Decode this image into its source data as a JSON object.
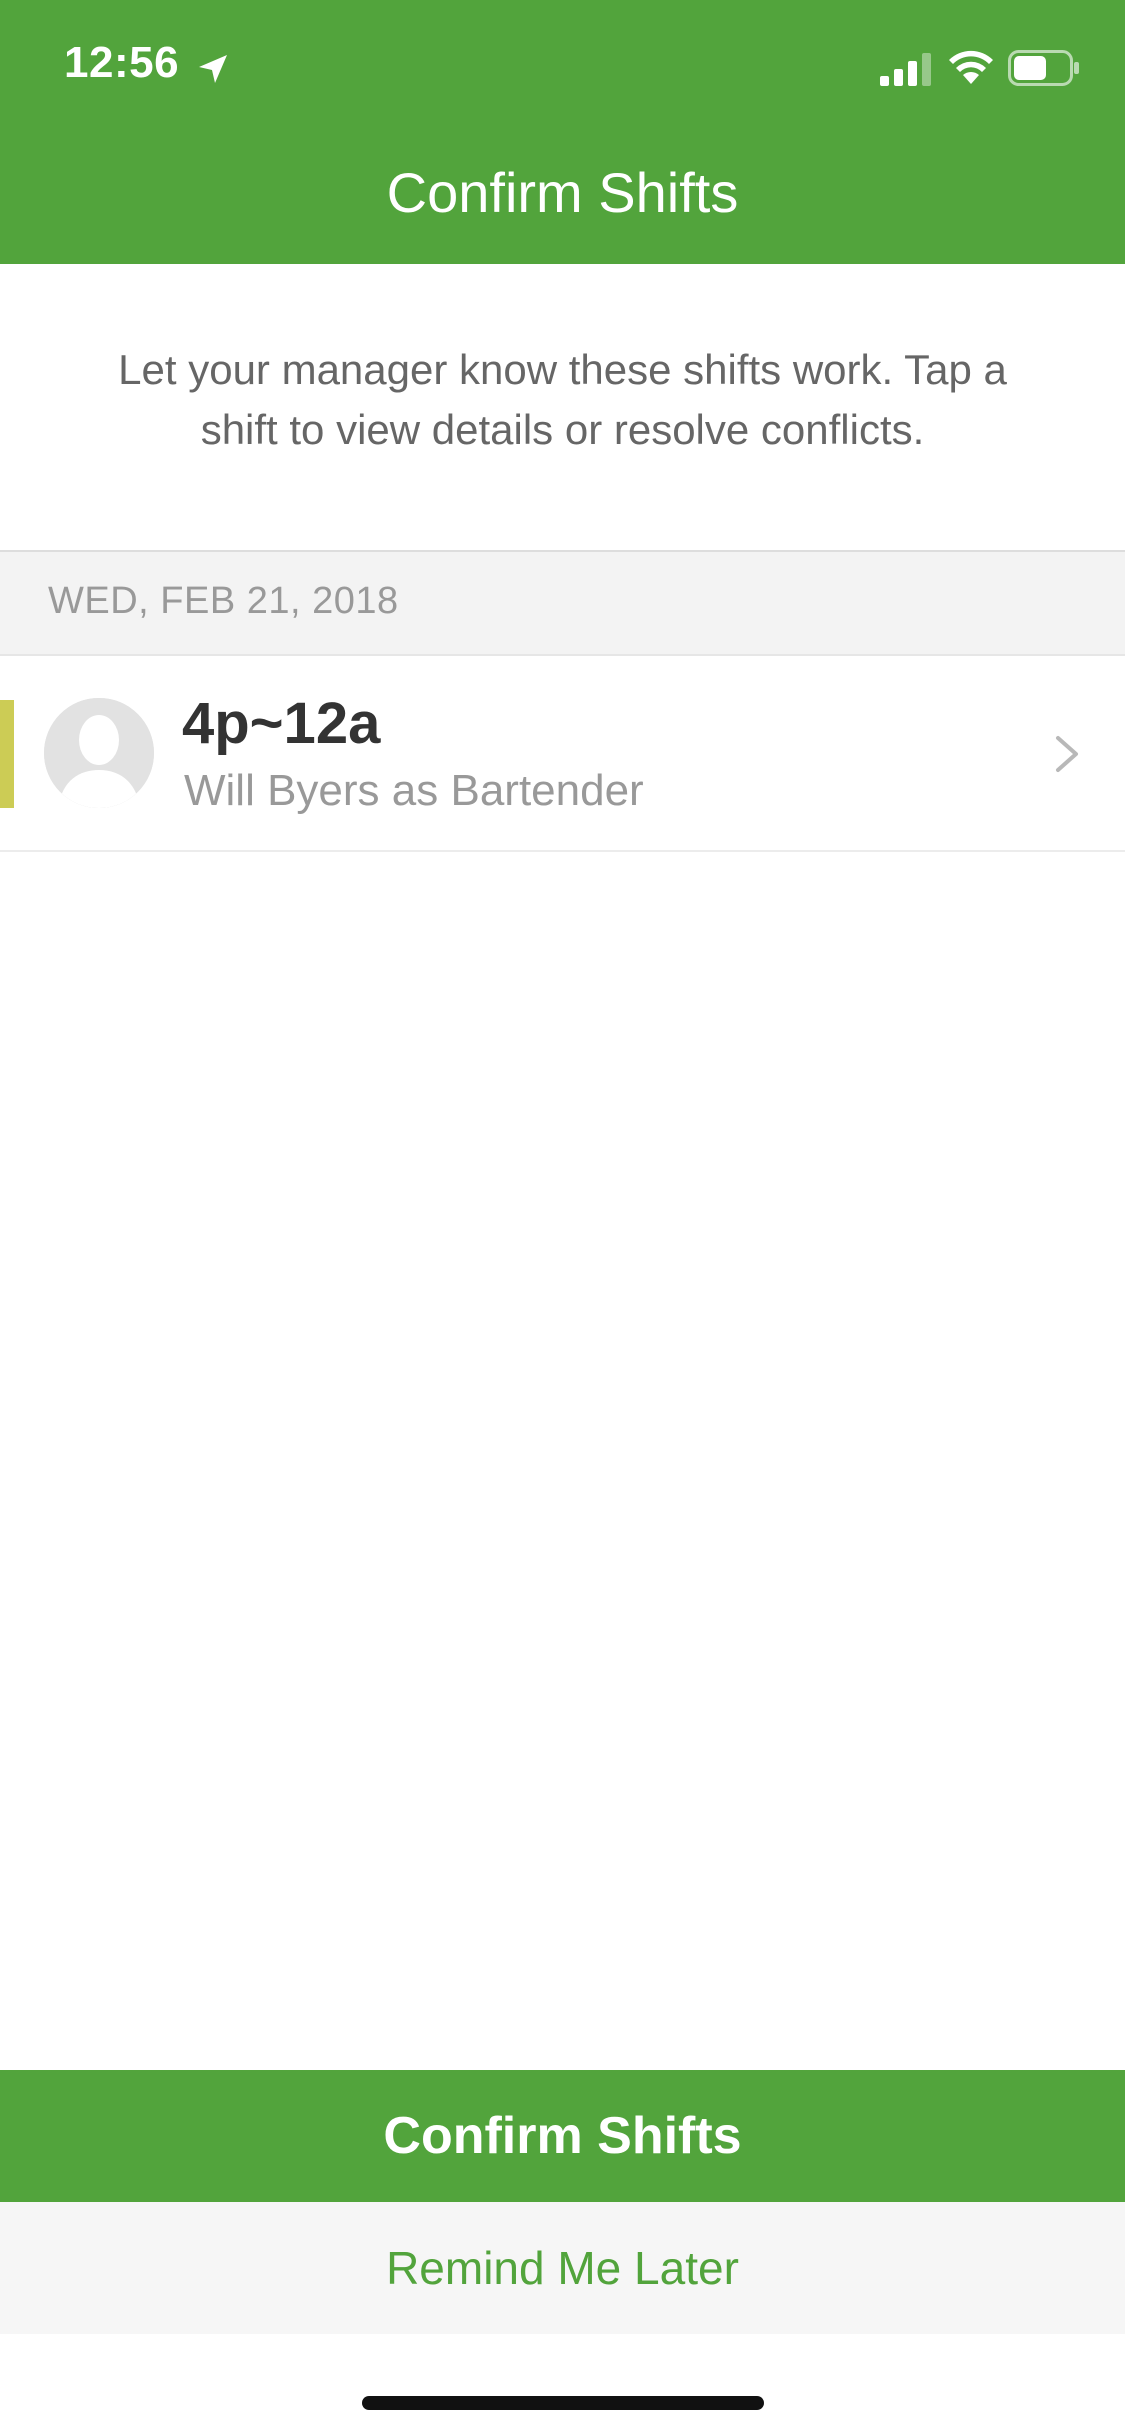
{
  "status_bar": {
    "time": "12:56",
    "icons": [
      "location-arrow-icon",
      "cellular-signal-icon",
      "wifi-icon",
      "battery-icon"
    ]
  },
  "nav": {
    "title": "Confirm Shifts"
  },
  "intro": {
    "message": "Let your manager know these shifts work. Tap a shift to view details or resolve conflicts."
  },
  "sections": [
    {
      "date": "WED, FEB 21, 2018",
      "shifts": [
        {
          "time": "4p~12a",
          "detail": "Will Byers as Bartender",
          "status_color": "#cccc55",
          "avatar": "person-placeholder-icon"
        }
      ]
    }
  ],
  "actions": {
    "confirm_label": "Confirm Shifts",
    "remind_label": "Remind Me Later"
  },
  "colors": {
    "brand_green": "#52a43c",
    "section_bg": "#f3f3f3",
    "muted_text": "#999999",
    "body_text": "#666666"
  }
}
